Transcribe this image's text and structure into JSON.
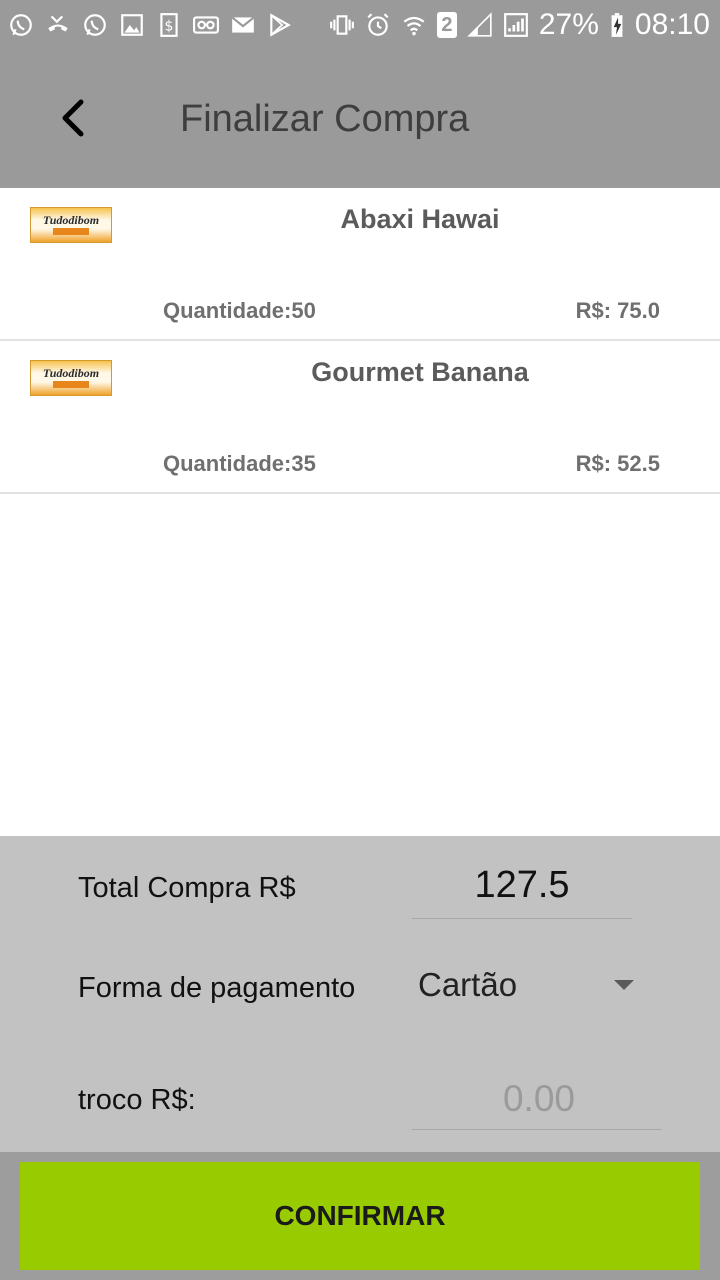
{
  "status_bar": {
    "left_icons": [
      "whatsapp-icon",
      "missed-call-icon",
      "whatsapp-icon",
      "image-icon",
      "dollar-icon",
      "voicemail-icon",
      "email-icon",
      "play-store-icon"
    ],
    "sim_badge": "2",
    "battery": "27%",
    "time": "08:10"
  },
  "app_bar": {
    "title": "Finalizar Compra",
    "back_icon": "back-arrow-icon"
  },
  "cart": {
    "items": [
      {
        "logo_text": "Tudodibom",
        "name": "Abaxi Hawai",
        "quantity": "Quantidade:50",
        "price": "R$: 75.0"
      },
      {
        "logo_text": "Tudodibom",
        "name": "Gourmet Banana",
        "quantity": "Quantidade:35",
        "price": "R$: 52.5"
      }
    ]
  },
  "summary": {
    "total_label": "Total Compra R$",
    "total_value": "127.5",
    "payment_label": "Forma de pagamento",
    "payment_value": "Cartão",
    "change_label": "troco R$:",
    "change_placeholder": "0.00"
  },
  "actions": {
    "confirm_label": "CONFIRMAR"
  },
  "colors": {
    "app_bar": "#9a9a9a",
    "panel": "#c2c2c2",
    "confirm": "#99cc00"
  }
}
